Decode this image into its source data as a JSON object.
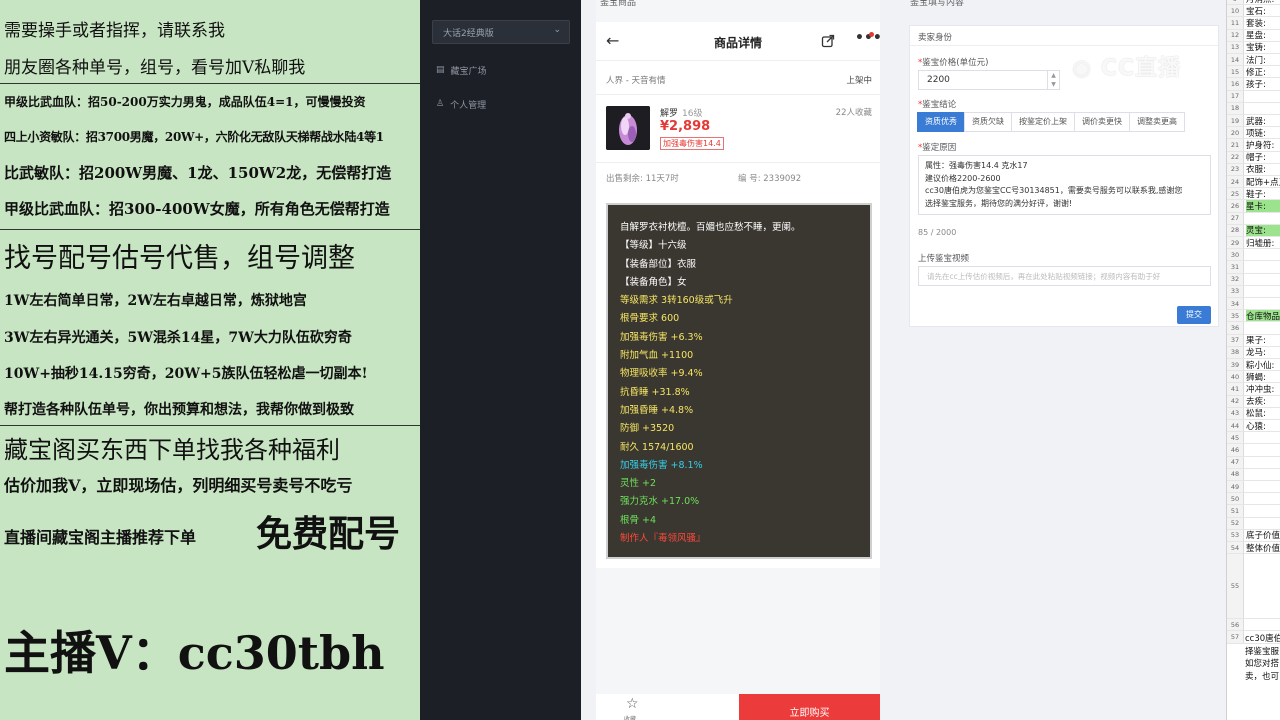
{
  "promo": {
    "lines": [
      "需要操手或者指挥，请联系我",
      "朋友圈各种单号，组号，看号加V私聊我",
      "甲级比武血队：招50-200万实力男鬼，成品队伍4=1，可慢慢投资",
      "四上小资敏队：招3700男魔，20W+，六阶化无敌队天梯帮战水陆4等1",
      "比武敏队：招200W男魔、1龙、150W2龙，无偿帮打造",
      "甲级比武血队：招300-400W女魔，所有角色无偿帮打造",
      "找号配号估号代售，组号调整",
      "1W左右简单日常，2W左右卓越日常，炼狱地宫",
      "3W左右异光通关，5W混杀14星，7W大力队伍砍穷奇",
      "10W+抽秒14.15穷奇，20W+5族队伍轻松虐一切副本!",
      "帮打造各种队伍单号，你出预算和想法，我帮你做到极致",
      "藏宝阁买东西下单找我各种福利",
      "估价加我V，立即现场估，列明细买号卖号不吃亏",
      "直播间藏宝阁主播推荐下单",
      "免费配号",
      "主播V：cc30tbh"
    ]
  },
  "sidebar": {
    "select_value": "大话2经典版",
    "items": [
      "藏宝广场",
      "个人管理"
    ]
  },
  "phone": {
    "header_label": "鉴宝商品",
    "title": "商品详情",
    "server": "人界 - 天音有情",
    "status": "上架中",
    "item_name": "解罗",
    "item_level": "16级",
    "favorites": "22人收藏",
    "price": "¥2,898",
    "tag": "加强毒伤害14.4",
    "remaining": "出售剩余: 11天7时",
    "id": "编 号: 2339092",
    "tooltip": [
      {
        "text": "自解罗衣衬枕檀。百媚也应愁不睡，更阑。",
        "color": "#ffffff"
      },
      {
        "text": "【等级】十六级",
        "color": "#ffffff"
      },
      {
        "text": "【装备部位】衣服",
        "color": "#ffffff"
      },
      {
        "text": "【装备角色】女",
        "color": "#ffffff"
      },
      {
        "text": "等级需求 3转160级或飞升",
        "color": "#f5e663"
      },
      {
        "text": "根骨要求 600",
        "color": "#f5e663"
      },
      {
        "text": "加强毒伤害 +6.3%",
        "color": "#f5e663"
      },
      {
        "text": "附加气血 +1100",
        "color": "#f5e663"
      },
      {
        "text": "物理吸收率 +9.4%",
        "color": "#f5e663"
      },
      {
        "text": "抗昏睡 +31.8%",
        "color": "#f5e663"
      },
      {
        "text": "加强昏睡 +4.8%",
        "color": "#f5e663"
      },
      {
        "text": "防御 +3520",
        "color": "#f5e663"
      },
      {
        "text": "耐久 1574/1600",
        "color": "#f5e663"
      },
      {
        "text": "加强毒伤害 +8.1%",
        "color": "#35d0e8"
      },
      {
        "text": "灵性 +2",
        "color": "#6ee05a"
      },
      {
        "text": "强力克水 +17.0%",
        "color": "#6ee05a"
      },
      {
        "text": "根骨 +4",
        "color": "#6ee05a"
      },
      {
        "text": "制作人『毒领风骚』",
        "color": "#ff4a3a"
      }
    ],
    "buy_label": "立即购买",
    "fav_label": "收藏"
  },
  "appraisal": {
    "header_label": "鉴宝填写内容",
    "section_title": "卖家身份",
    "price_label": "鉴宝价格(单位元)",
    "price_value": "2200",
    "conclusion_label": "鉴宝结论",
    "options": [
      "资质优秀",
      "资质欠缺",
      "按鉴定价上架",
      "调价卖更快",
      "调整卖更高"
    ],
    "selected": 0,
    "reason_label": "鉴定原因",
    "reason_lines": [
      "属性：强毒伤害14.4 克水17",
      "建议价格2200-2600",
      "cc30唐伯虎为您鉴宝CC号30134851，需要卖号服务可以联系我,感谢您",
      "选择鉴宝服务，期待您的满分好评，谢谢!"
    ],
    "counter": "85 / 2000",
    "video_label": "上传鉴宝视频",
    "video_placeholder": "请先在cc上传估价视频后，再在此处粘贴视频链接；视频内容有助于好",
    "submit_label": "提交",
    "watermark": "CC直播"
  },
  "sheet": {
    "rows": [
      {
        "n": "9",
        "t": "月消点:"
      },
      {
        "n": "10",
        "t": "宝石:"
      },
      {
        "n": "11",
        "t": "套装:"
      },
      {
        "n": "12",
        "t": "星盘:"
      },
      {
        "n": "13",
        "t": "宝铸:"
      },
      {
        "n": "14",
        "t": "法门:"
      },
      {
        "n": "15",
        "t": "修正:"
      },
      {
        "n": "16",
        "t": "孩子:"
      },
      {
        "n": "17",
        "t": ""
      },
      {
        "n": "18",
        "t": ""
      },
      {
        "n": "19",
        "t": "武器:"
      },
      {
        "n": "20",
        "t": "项链:"
      },
      {
        "n": "21",
        "t": "护身符:"
      },
      {
        "n": "22",
        "t": "帽子:"
      },
      {
        "n": "23",
        "t": "衣服:"
      },
      {
        "n": "24",
        "t": "配饰+点卫"
      },
      {
        "n": "25",
        "t": "鞋子:"
      },
      {
        "n": "26",
        "t": "星卡:"
      },
      {
        "n": "27",
        "t": ""
      },
      {
        "n": "28",
        "t": "灵宝:"
      },
      {
        "n": "29",
        "t": "归墟册:"
      },
      {
        "n": "30",
        "t": ""
      },
      {
        "n": "31",
        "t": ""
      },
      {
        "n": "32",
        "t": ""
      },
      {
        "n": "33",
        "t": ""
      },
      {
        "n": "34",
        "t": ""
      },
      {
        "n": "35",
        "t": "仓库物品"
      },
      {
        "n": "36",
        "t": ""
      },
      {
        "n": "37",
        "t": "果子:"
      },
      {
        "n": "38",
        "t": "龙马:"
      },
      {
        "n": "39",
        "t": "粽小仙:"
      },
      {
        "n": "40",
        "t": "狮蝎:"
      },
      {
        "n": "41",
        "t": "冲冲虫:"
      },
      {
        "n": "42",
        "t": "去疾:"
      },
      {
        "n": "43",
        "t": "松鼠:"
      },
      {
        "n": "44",
        "t": "心猿:"
      },
      {
        "n": "45",
        "t": ""
      },
      {
        "n": "46",
        "t": ""
      },
      {
        "n": "47",
        "t": ""
      },
      {
        "n": "48",
        "t": ""
      },
      {
        "n": "49",
        "t": ""
      },
      {
        "n": "50",
        "t": ""
      },
      {
        "n": "51",
        "t": ""
      },
      {
        "n": "52",
        "t": ""
      },
      {
        "n": "53",
        "t": "底子价值"
      },
      {
        "n": "54",
        "t": "整体价值"
      },
      {
        "n": "55",
        "t": ""
      },
      {
        "n": "56",
        "t": ""
      },
      {
        "n": "57",
        "t": ""
      }
    ],
    "note_lines": [
      "cc30唐伯",
      "择鉴宝服",
      "如您对搭",
      "卖，也可"
    ]
  },
  "colors": {
    "promo_bg": "#c7e5c2",
    "sidebar_bg": "#1c1f26",
    "accent_blue": "#3a7bd5",
    "buy_red": "#ec3b3b",
    "price_red": "#e53935",
    "sheet_green": "#9be38c"
  },
  "icons": [
    "back-arrow-icon",
    "share-icon",
    "more-icon",
    "star-icon",
    "chevron-down-icon",
    "store-icon",
    "user-icon"
  ]
}
